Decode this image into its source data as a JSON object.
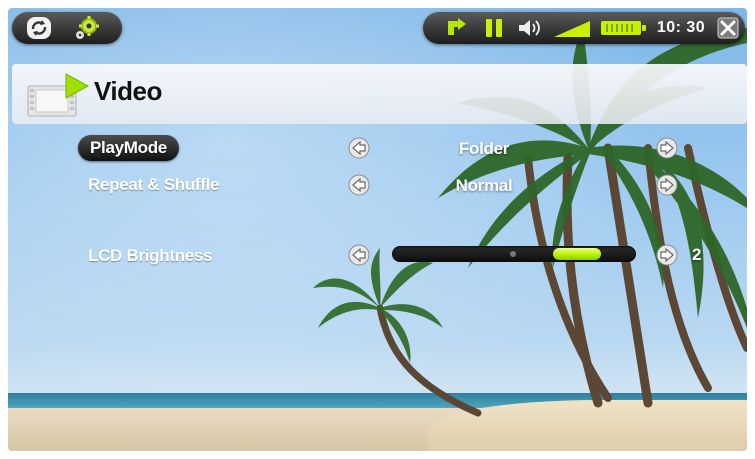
{
  "statusbar": {
    "left_icons": [
      "sync-icon",
      "settings-gear-icon"
    ],
    "right_icons": [
      "usb-connection-icon",
      "pause-icon",
      "speaker-volume-icon",
      "signal-strength-icon",
      "battery-icon",
      "close-icon"
    ],
    "clock": "10: 30"
  },
  "header": {
    "title": "Video",
    "icon": "video-filmstrip-icon"
  },
  "settings": {
    "rows": [
      {
        "label": "PlayMode",
        "value": "Folder",
        "selected": true
      },
      {
        "label": "Repeat & Shuffle",
        "value": "Normal",
        "selected": false
      },
      {
        "label": "LCD Brightness",
        "value": "2",
        "selected": false
      }
    ],
    "brightness_level_fraction": 0.84
  },
  "colors": {
    "accent_green": "#b9f000",
    "bar_dark": "#1d1d1d",
    "text": "#ffffff"
  }
}
